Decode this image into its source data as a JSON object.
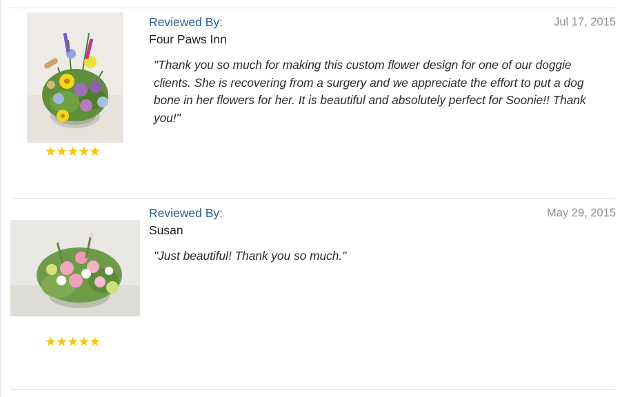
{
  "reviews": [
    {
      "label": "Reviewed By:",
      "reviewer": "Four Paws Inn",
      "date": "Jul 17, 2015",
      "text": "\"Thank you so much for making this custom flower design for one of our doggie clients. She is recovering from a surgery and we appreciate the effort to put a dog bone in her flowers for her. It is beautiful and absolutely perfect for Soonie!! Thank you!\"",
      "rating": 5,
      "stars": "★★★★★",
      "image": "flower-arrangement-photo"
    },
    {
      "label": "Reviewed By:",
      "reviewer": "Susan",
      "date": "May 29, 2015",
      "text": "\"Just beautiful! Thank you so much.\"",
      "rating": 5,
      "stars": "★★★★★",
      "image": "flower-arrangement-photo"
    }
  ],
  "colors": {
    "label": "#2c5f8e",
    "date": "#8f8f8f",
    "star": "#f4c50a",
    "divider": "#dcdcdc"
  }
}
